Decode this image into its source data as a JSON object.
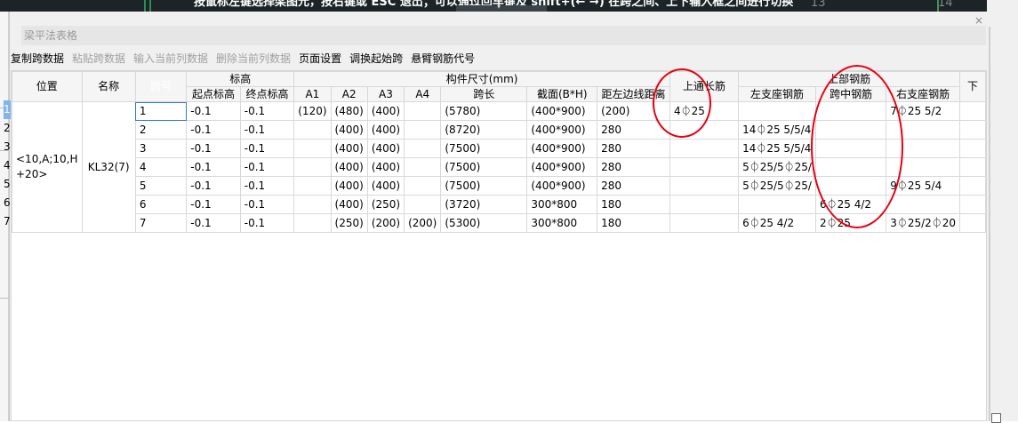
{
  "banner_text": "按鼠标左键选择梁图元，按右键或 ESC 退出；可以通过回车键及 shift+(← →) 在跨之间、上下输入框之间进行切换",
  "banner_numbers": [
    "13",
    "14"
  ],
  "dialog": {
    "title": "梁平法表格",
    "close_label": "×",
    "toolbar": [
      {
        "label": "复制跨数据",
        "enabled": true
      },
      {
        "label": "粘贴跨数据",
        "enabled": false
      },
      {
        "label": "输入当前列数据",
        "enabled": false
      },
      {
        "label": "删除当前列数据",
        "enabled": false
      },
      {
        "label": "页面设置",
        "enabled": true
      },
      {
        "label": "调换起始跨",
        "enabled": true
      },
      {
        "label": "悬臂钢筋代号",
        "enabled": true
      }
    ]
  },
  "table": {
    "group_headers": {
      "position": "位置",
      "name": "名称",
      "span_no": "跨号",
      "elevation": "标高",
      "dimensions": "构件尺寸(mm)",
      "top_through": "上通长筋",
      "top_rebar": "上部钢筋",
      "bottom_partial": "下"
    },
    "sub_headers": {
      "start_elev": "起点标高",
      "end_elev": "终点标高",
      "a1": "A1",
      "a2": "A2",
      "a3": "A3",
      "a4": "A4",
      "span_len": "跨长",
      "section": "截面(B*H)",
      "edge_dist": "距左边线距离",
      "left_support": "左支座钢筋",
      "mid_span": "跨中钢筋",
      "right_support": "右支座钢筋"
    },
    "position_value": "<10,A;10,H +20>",
    "name_value": "KL32(7)",
    "row_numbers": [
      "1",
      "2",
      "3",
      "4",
      "5",
      "6",
      "7"
    ],
    "rows": [
      {
        "span": "1",
        "start": "-0.1",
        "end": "-0.1",
        "a1": "(120)",
        "a2": "(480)",
        "a3": "(400)",
        "a4": "",
        "len": "(5780)",
        "sec": "(400*900)",
        "dist": "(200)",
        "through": "4⏀25",
        "left": "",
        "mid": "",
        "right": "7⏀25 5/2"
      },
      {
        "span": "2",
        "start": "-0.1",
        "end": "-0.1",
        "a1": "",
        "a2": "(400)",
        "a3": "(400)",
        "a4": "",
        "len": "(8720)",
        "sec": "(400*900)",
        "dist": "280",
        "through": "",
        "left": "14⏀25 5/5/4",
        "mid": "",
        "right": ""
      },
      {
        "span": "3",
        "start": "-0.1",
        "end": "-0.1",
        "a1": "",
        "a2": "(400)",
        "a3": "(400)",
        "a4": "",
        "len": "(7500)",
        "sec": "(400*900)",
        "dist": "280",
        "through": "",
        "left": "14⏀25 5/5/4",
        "mid": "",
        "right": ""
      },
      {
        "span": "4",
        "start": "-0.1",
        "end": "-0.1",
        "a1": "",
        "a2": "(400)",
        "a3": "(400)",
        "a4": "",
        "len": "(7500)",
        "sec": "(400*900)",
        "dist": "280",
        "through": "",
        "left": "5⏀25/5⏀25/",
        "mid": "",
        "right": ""
      },
      {
        "span": "5",
        "start": "-0.1",
        "end": "-0.1",
        "a1": "",
        "a2": "(400)",
        "a3": "(400)",
        "a4": "",
        "len": "(7500)",
        "sec": "(400*900)",
        "dist": "280",
        "through": "",
        "left": "5⏀25/5⏀25/",
        "mid": "",
        "right": "9⏀25 5/4"
      },
      {
        "span": "6",
        "start": "-0.1",
        "end": "-0.1",
        "a1": "",
        "a2": "(400)",
        "a3": "(250)",
        "a4": "",
        "len": "(3720)",
        "sec": "300*800",
        "dist": "180",
        "through": "",
        "left": "",
        "mid": "6⏀25 4/2",
        "right": ""
      },
      {
        "span": "7",
        "start": "-0.1",
        "end": "-0.1",
        "a1": "",
        "a2": "(250)",
        "a3": "(200)",
        "a4": "(200)",
        "len": "(5300)",
        "sec": "300*800",
        "dist": "180",
        "through": "",
        "left": "6⏀25 4/2",
        "mid": "2⏀25",
        "right": "3⏀25/2⏀20"
      }
    ]
  },
  "colors": {
    "selected_header": "#7fb5ec",
    "annotation_red": "#e60012",
    "dialog_bg": "#f0f0f0",
    "banner_bg": "#1d2427"
  }
}
